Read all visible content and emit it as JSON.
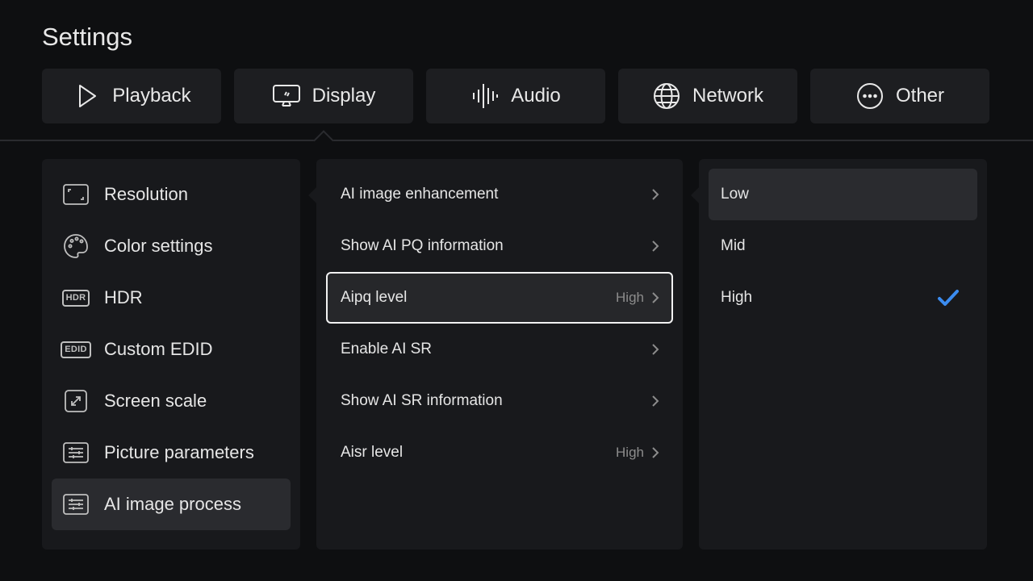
{
  "page_title": "Settings",
  "tabs": [
    {
      "label": "Playback",
      "icon": "play-icon"
    },
    {
      "label": "Display",
      "icon": "display-icon"
    },
    {
      "label": "Audio",
      "icon": "audio-wave-icon"
    },
    {
      "label": "Network",
      "icon": "globe-icon"
    },
    {
      "label": "Other",
      "icon": "more-dots-icon"
    }
  ],
  "selected_tab": "Display",
  "left_menu": [
    {
      "label": "Resolution",
      "icon": "resolution-icon"
    },
    {
      "label": "Color settings",
      "icon": "palette-icon"
    },
    {
      "label": "HDR",
      "icon": "hdr-icon",
      "badge": "HDR"
    },
    {
      "label": "Custom EDID",
      "icon": "edid-icon",
      "badge": "EDID"
    },
    {
      "label": "Screen scale",
      "icon": "screen-scale-icon"
    },
    {
      "label": "Picture parameters",
      "icon": "sliders-icon"
    },
    {
      "label": "AI image process",
      "icon": "sliders-icon"
    }
  ],
  "left_active": "AI image process",
  "mid_menu": [
    {
      "label": "AI image enhancement",
      "value": ""
    },
    {
      "label": "Show AI PQ information",
      "value": ""
    },
    {
      "label": "Aipq level",
      "value": "High"
    },
    {
      "label": "Enable AI SR",
      "value": ""
    },
    {
      "label": "Show AI SR information",
      "value": ""
    },
    {
      "label": "Aisr level",
      "value": "High"
    }
  ],
  "mid_focused": "Aipq level",
  "options": [
    {
      "label": "Low"
    },
    {
      "label": "Mid"
    },
    {
      "label": "High"
    }
  ],
  "option_highlighted": "Low",
  "option_selected": "High",
  "colors": {
    "accent": "#3b8cf0",
    "background": "#0e0f11",
    "panel": "#18191c"
  }
}
